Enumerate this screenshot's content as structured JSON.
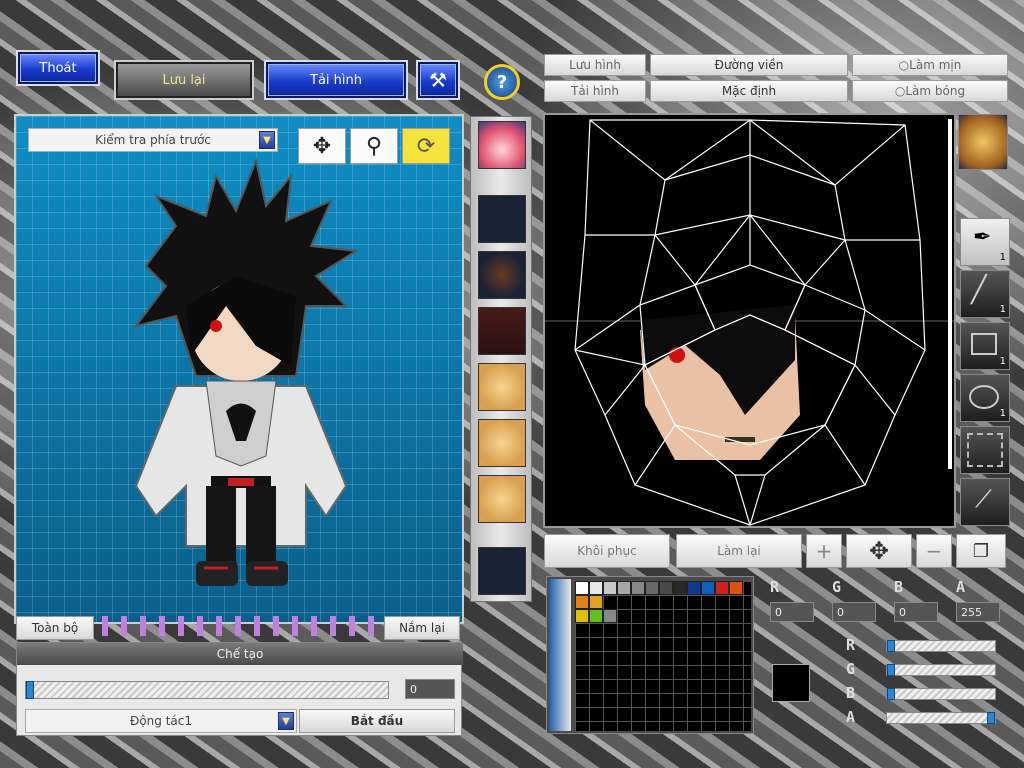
{
  "top_left": {
    "exit": "Thoát",
    "save": "Lưu lại",
    "load": "Tải hình"
  },
  "help": "?",
  "view": {
    "selected": "Kiểm tra phía trước"
  },
  "bottom_left": {
    "all": "Toàn bộ",
    "grab": "Nắm lại",
    "create": "Chế tạo",
    "progress_value": "0",
    "action_selected": "Động tác1",
    "start": "Bắt đầu"
  },
  "right_top": {
    "save_img": "Lưu hình",
    "load_img": "Tải hình",
    "outline": "Đường viền",
    "default": "Mặc định",
    "smooth": "Làm mịn",
    "gloss": "Làm bóng"
  },
  "right_bottom": {
    "restore": "Khôi phục",
    "redo": "Làm lại"
  },
  "side_tools": [
    "1",
    "1",
    "1",
    "1"
  ],
  "rgba": {
    "r": "0",
    "g": "0",
    "b": "0",
    "a": "255"
  },
  "channel_labels": {
    "r": "R",
    "g": "G",
    "b": "B",
    "a": "A"
  },
  "palette_row1": [
    "#ffffff",
    "#e8e8e8",
    "#c8c8c8",
    "#a8a8a8",
    "#888888",
    "#686868",
    "#484848",
    "#282828",
    "#103890",
    "#1060c0",
    "#d02020",
    "#e05010",
    "#e08010",
    "#e0a020"
  ],
  "palette_row2": [
    "#e0c000",
    "#60c020",
    "#888888"
  ],
  "current_color": "#000000",
  "colors": {
    "panel_blue": "#0d7fb3",
    "button_blue": "#1a3ccc",
    "slider_blue": "#2a86d6"
  }
}
